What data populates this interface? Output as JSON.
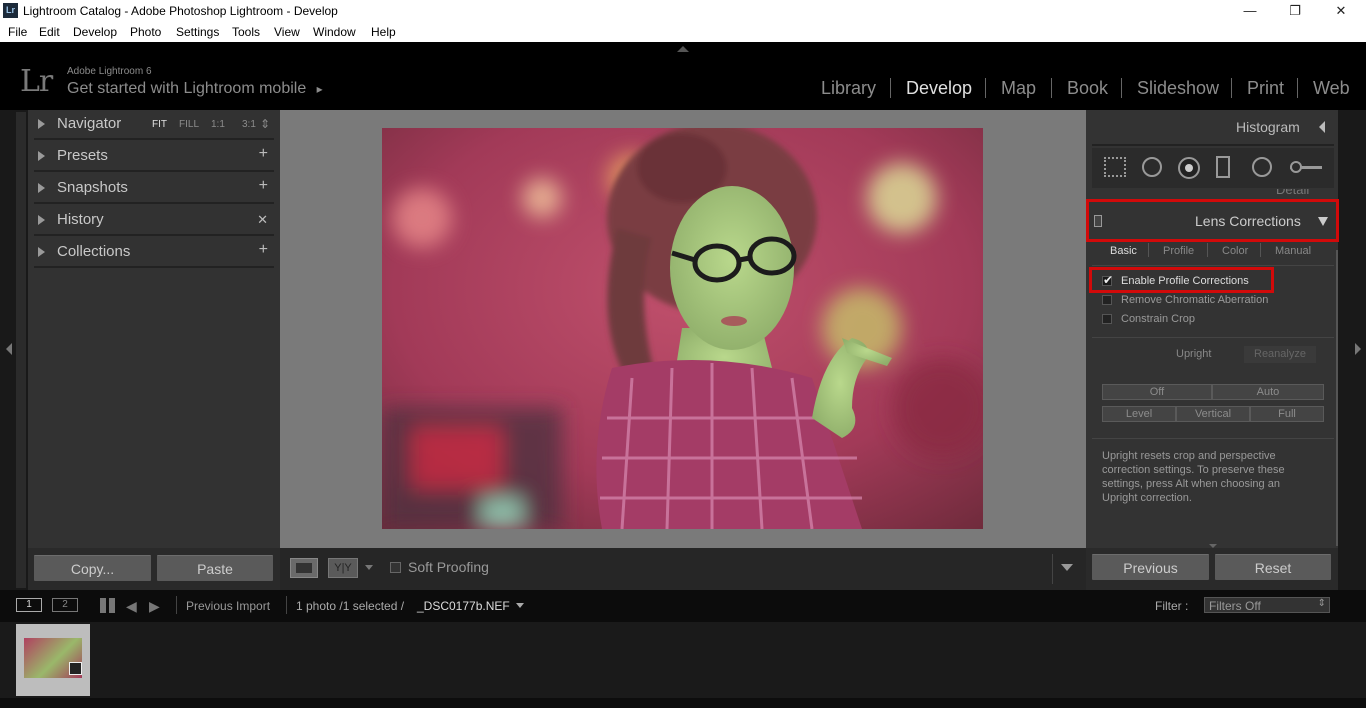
{
  "window": {
    "title": "Lightroom Catalog - Adobe Photoshop Lightroom - Develop",
    "app_icon": "Lr",
    "controls": [
      "—",
      "❐",
      "✕"
    ]
  },
  "menu": [
    "File",
    "Edit",
    "Develop",
    "Photo",
    "Settings",
    "Tools",
    "View",
    "Window",
    "Help"
  ],
  "identity": {
    "logo": "Lr",
    "product": "Adobe Lightroom 6",
    "mobile_prompt": "Get started with Lightroom mobile",
    "mobile_arrow": "▸"
  },
  "modules": {
    "items": [
      "Library",
      "Develop",
      "Map",
      "Book",
      "Slideshow",
      "Print",
      "Web"
    ],
    "active": "Develop"
  },
  "left_panel": {
    "navigator": {
      "label": "Navigator",
      "zoom": [
        "FIT",
        "FILL",
        "1:1",
        "3:1"
      ],
      "zoom_selected": "FIT",
      "zoom_arrow": "⇕"
    },
    "presets": {
      "label": "Presets",
      "action": "+"
    },
    "snapshots": {
      "label": "Snapshots",
      "action": "+"
    },
    "history": {
      "label": "History",
      "action": "✕"
    },
    "collections": {
      "label": "Collections",
      "action": "+"
    },
    "copy_label": "Copy...",
    "paste_label": "Paste"
  },
  "toolbar": {
    "soft_proofing": "Soft Proofing",
    "compare_label": "Y|Y"
  },
  "right_panel": {
    "histogram_label": "Histogram",
    "detail_label": "Detail",
    "lens_corrections": "Lens Corrections",
    "tabs": [
      "Basic",
      "Profile",
      "Color",
      "Manual"
    ],
    "active_tab": "Basic",
    "checks": [
      {
        "label": "Enable Profile Corrections",
        "checked": true
      },
      {
        "label": "Remove Chromatic Aberration",
        "checked": false
      },
      {
        "label": "Constrain Crop",
        "checked": false
      }
    ],
    "upright_label": "Upright",
    "reanalyze_label": "Reanalyze",
    "upright_buttons_row1": [
      "Off",
      "Auto"
    ],
    "upright_buttons_row2": [
      "Level",
      "Vertical",
      "Full"
    ],
    "upright_help": "Upright resets crop and perspective correction settings. To preserve these settings, press Alt when choosing an Upright correction.",
    "previous_label": "Previous",
    "reset_label": "Reset"
  },
  "filmstrip_bar": {
    "screen1": "1",
    "screen2": "2",
    "source": "Previous Import",
    "info": "1 photo /1 selected /",
    "filename": "_DSC0177b.NEF",
    "filter_label": "Filter :",
    "filter_value": "Filters Off"
  },
  "colors": {
    "highlight_red": "#d20a0a",
    "panel_bg": "#323232",
    "center_bg": "#7a7a7a"
  }
}
